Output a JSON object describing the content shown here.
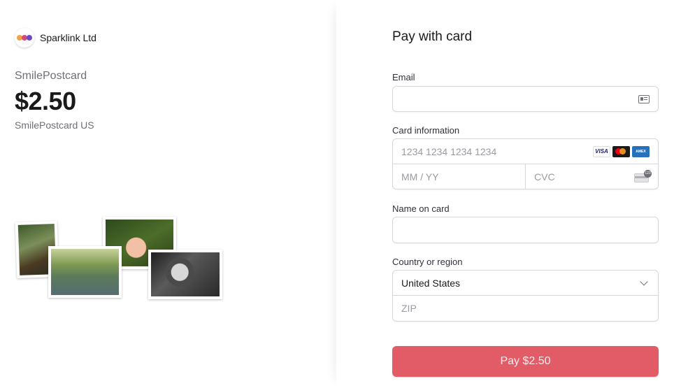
{
  "merchant": {
    "name": "Sparklink Ltd",
    "logo_colors": [
      "#f0a24a",
      "#d9487a",
      "#6a4bc4"
    ]
  },
  "product": {
    "name": "SmilePostcard",
    "price": "$2.50",
    "description": "SmilePostcard US"
  },
  "form": {
    "title": "Pay with card",
    "email": {
      "label": "Email",
      "value": "",
      "icon": "contact-card-icon"
    },
    "card": {
      "label": "Card information",
      "number_placeholder": "1234 1234 1234 1234",
      "expiry_placeholder": "MM / YY",
      "cvc_placeholder": "CVC",
      "brands": [
        "VISA",
        "mastercard",
        "AMEX"
      ]
    },
    "name_on_card": {
      "label": "Name on card",
      "value": ""
    },
    "country": {
      "label": "Country or region",
      "selected": "United States",
      "zip_placeholder": "ZIP"
    },
    "pay_button": "Pay $2.50"
  },
  "colors": {
    "accent": "#e25c68",
    "text": "#30313d",
    "muted": "#6d6e78"
  }
}
